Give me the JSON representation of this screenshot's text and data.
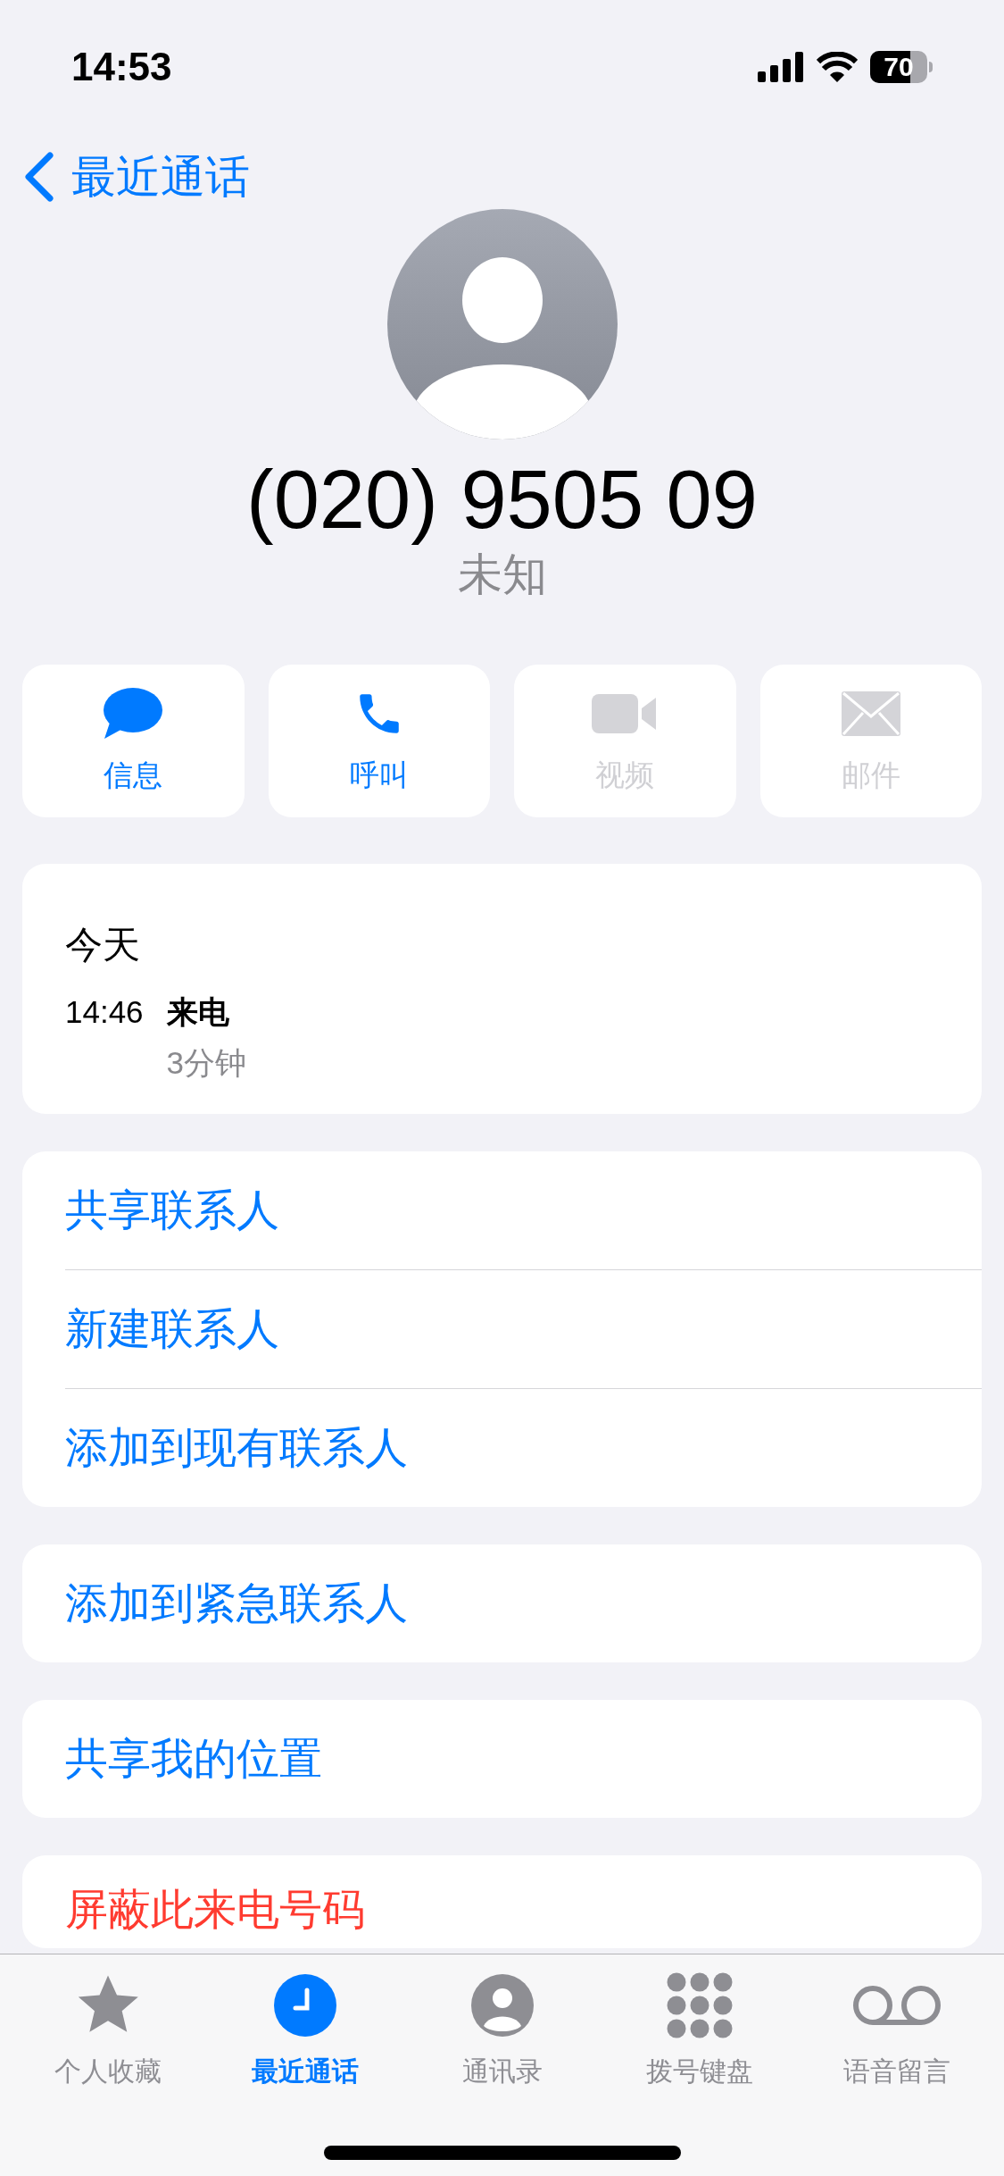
{
  "status_bar": {
    "time": "14:53",
    "battery": "70"
  },
  "nav": {
    "back_label": "最近通话"
  },
  "contact": {
    "number": "(020) 9505 09",
    "label": "未知"
  },
  "actions": [
    {
      "kind": "message",
      "label": "信息",
      "disabled": false
    },
    {
      "kind": "call",
      "label": "呼叫",
      "disabled": false
    },
    {
      "kind": "video",
      "label": "视频",
      "disabled": true
    },
    {
      "kind": "mail",
      "label": "邮件",
      "disabled": true
    }
  ],
  "recent_calls": {
    "date": "今天",
    "calls": [
      {
        "time": "14:46",
        "type": "来电",
        "duration": "3分钟"
      }
    ]
  },
  "option_groups": [
    {
      "items": [
        {
          "label": "共享联系人",
          "kind": "normal"
        },
        {
          "label": "新建联系人",
          "kind": "normal"
        },
        {
          "label": "添加到现有联系人",
          "kind": "normal"
        }
      ]
    },
    {
      "items": [
        {
          "label": "添加到紧急联系人",
          "kind": "normal"
        }
      ]
    },
    {
      "items": [
        {
          "label": "共享我的位置",
          "kind": "normal"
        }
      ]
    },
    {
      "items": [
        {
          "label": "屏蔽此来电号码",
          "kind": "destructive"
        }
      ]
    }
  ],
  "tab_bar": [
    {
      "kind": "favorites",
      "label": "个人收藏",
      "selected": false
    },
    {
      "kind": "recents",
      "label": "最近通话",
      "selected": true
    },
    {
      "kind": "contacts",
      "label": "通讯录",
      "selected": false
    },
    {
      "kind": "keypad",
      "label": "拨号键盘",
      "selected": false
    },
    {
      "kind": "voicemail",
      "label": "语音留言",
      "selected": false
    }
  ]
}
